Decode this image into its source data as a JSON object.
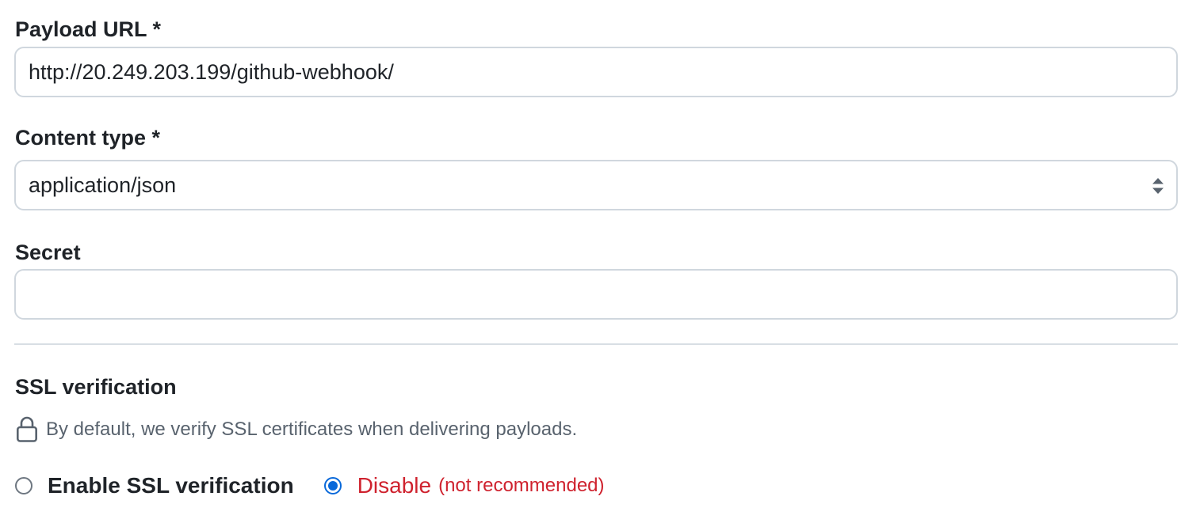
{
  "payload_url": {
    "label": "Payload URL *",
    "value": "http://20.249.203.199/github-webhook/"
  },
  "content_type": {
    "label": "Content type *",
    "selected": "application/json",
    "icon": "select-updown-arrows-icon"
  },
  "secret": {
    "label": "Secret",
    "value": ""
  },
  "ssl": {
    "heading": "SSL verification",
    "note": "By default, we verify SSL certificates when delivering payloads.",
    "note_icon": "lock-icon",
    "options": [
      {
        "label": "Enable SSL verification",
        "checked": false
      },
      {
        "label": "Disable",
        "note": "(not recommended)",
        "checked": true
      }
    ]
  },
  "colors": {
    "text": "#1f2328",
    "muted": "#59636e",
    "border": "#d0d7de",
    "danger": "#cf222e",
    "accent": "#0969da"
  }
}
